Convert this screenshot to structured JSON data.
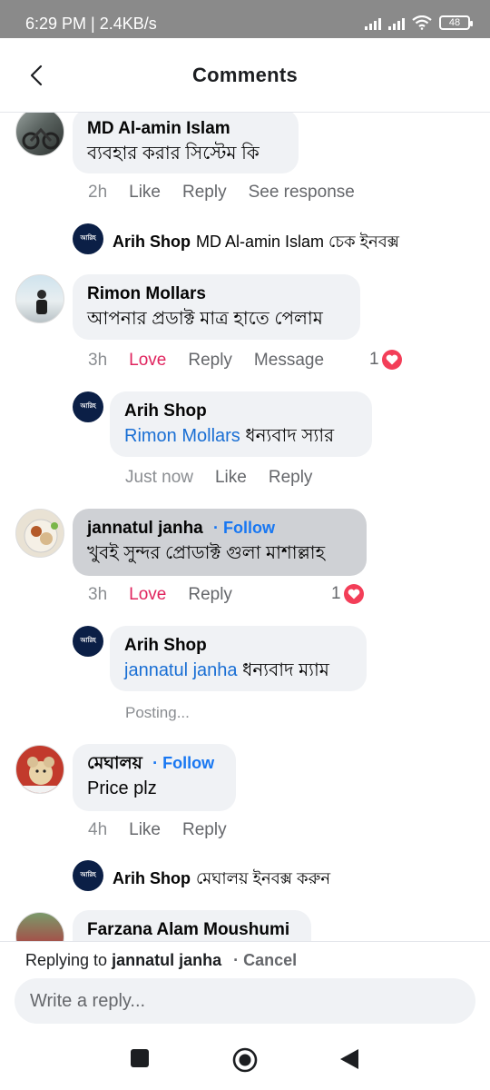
{
  "status_bar": {
    "time": "6:29 PM | 2.4KB/s",
    "battery": "48"
  },
  "header": {
    "title": "Comments"
  },
  "comments": [
    {
      "name": "MD Al-amin Islam",
      "text": "ব্যবহার করার সিস্টেম কি",
      "time": "2h",
      "like": "Like",
      "reply": "Reply",
      "extra": "See response",
      "reply_preview": {
        "name": "Arih Shop",
        "text": "MD Al-amin Islam চেক ইনবক্স"
      }
    },
    {
      "name": "Rimon Mollars",
      "text": "আপনার প্রডাক্ট মাত্র হাতে পেলাম",
      "time": "3h",
      "like": "Love",
      "reply": "Reply",
      "extra": "Message",
      "reaction_count": "1",
      "reply_full": {
        "name": "Arih Shop",
        "tag": "Rimon Mollars",
        "text": "ধন্যবাদ স্যার",
        "time": "Just now",
        "like": "Like",
        "reply": "Reply"
      }
    },
    {
      "name": "jannatul janha",
      "follow": "Follow",
      "text": "খুবই সুন্দর প্রোডাক্ট গুলা মাশাল্লাহ",
      "time": "3h",
      "like": "Love",
      "reply": "Reply",
      "reaction_count": "1",
      "reply_full": {
        "name": "Arih Shop",
        "tag": "jannatul janha",
        "text": "ধন্যবাদ ম্যাম",
        "status": "Posting..."
      }
    },
    {
      "name": "মেঘালয়",
      "follow": "Follow",
      "text": "Price plz",
      "time": "4h",
      "like": "Like",
      "reply": "Reply",
      "reply_preview": {
        "name": "Arih Shop",
        "text": "মেঘালয়  ইনবক্স করুন"
      }
    },
    {
      "name": "Farzana Alam Moushumi"
    }
  ],
  "shop_logo_text": "আরিহ",
  "reply_bar": {
    "prefix": "Replying to",
    "target": "jannatul janha",
    "dot": "·",
    "cancel": "Cancel",
    "placeholder": "Write a reply..."
  },
  "icons": [
    "back-arrow-icon",
    "heart-reaction-icon",
    "square-nav-icon",
    "home-nav-icon",
    "back-nav-icon"
  ],
  "colors": {
    "love": "#e0245e",
    "follow": "#1877f2",
    "tag": "#1a6fd4",
    "bubble": "#f0f2f5",
    "selected_bubble": "#cfd1d5"
  }
}
